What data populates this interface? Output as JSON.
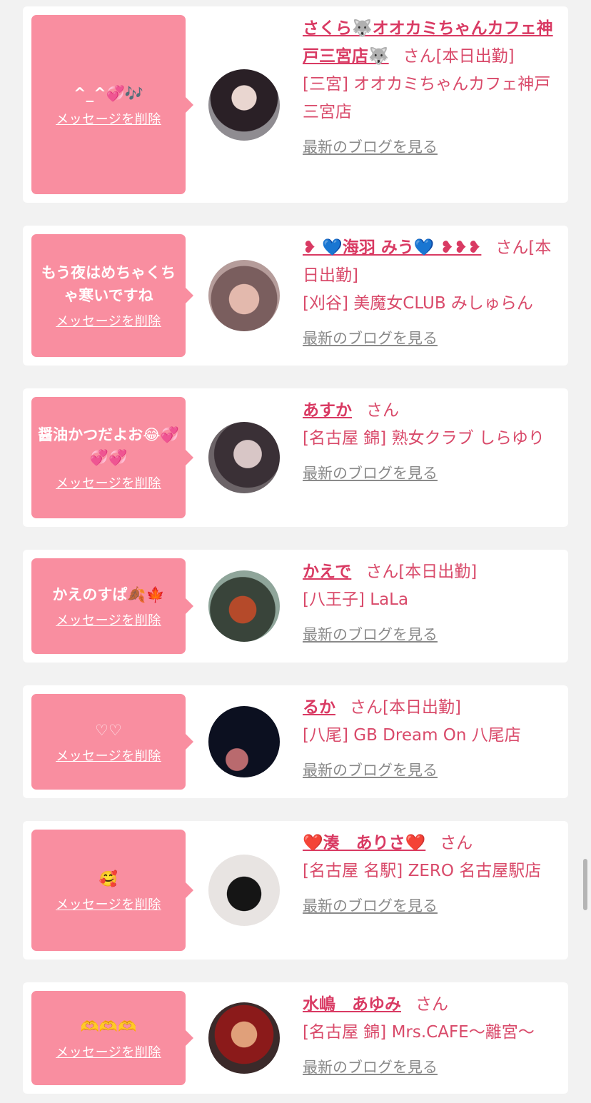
{
  "delete_label": "メッセージを削除",
  "blog_label": "最新のブログを見る",
  "san": "さん",
  "colors": {
    "bubble": "#f98ea0",
    "accent": "#d93a63",
    "link_gray": "#8a8a8a",
    "background": "#f2f2f2"
  },
  "cards": [
    {
      "message": "^_^💞🎶",
      "name": "さくら🐺オオカミちゃんカフェ神戸三宮店🐺",
      "status": "[本日出勤]",
      "shop": "[三宮] オオカミちゃんカフェ神戸三宮店",
      "avatar": "avatar-photo"
    },
    {
      "message": "もう夜はめちゃくちゃ寒いですね",
      "name": "❥ 💙海羽 みう💙 ❥❥❥",
      "status": "[本日出勤]",
      "shop": "[刈谷] 美魔女CLUB みしゅらん",
      "avatar": "avatar-photo"
    },
    {
      "message": "醤油かつだよお😂💞💞💞",
      "name": "あすか",
      "status": "",
      "shop": "[名古屋 錦] 熟女クラブ しらゆり",
      "avatar": "avatar-photo"
    },
    {
      "message": "かえのすぱ🍂🍁",
      "name": "かえで",
      "status": "[本日出勤]",
      "shop": "[八王子] LaLa",
      "avatar": "avatar-photo"
    },
    {
      "message": "♡♡",
      "name": "るか",
      "status": "[本日出勤]",
      "shop": "[八尾] GB Dream On 八尾店",
      "avatar": "avatar-photo"
    },
    {
      "message": "🥰",
      "name": "❤️湊　ありさ❤️",
      "status": "",
      "shop": "[名古屋 名駅] ZERO 名古屋駅店",
      "avatar": "avatar-photo"
    },
    {
      "message": "🫶🫶🫶",
      "name": "水嶋　あゆみ",
      "status": "",
      "shop": "[名古屋 錦] Mrs.CAFE〜離宮〜",
      "avatar": "avatar-photo"
    }
  ]
}
